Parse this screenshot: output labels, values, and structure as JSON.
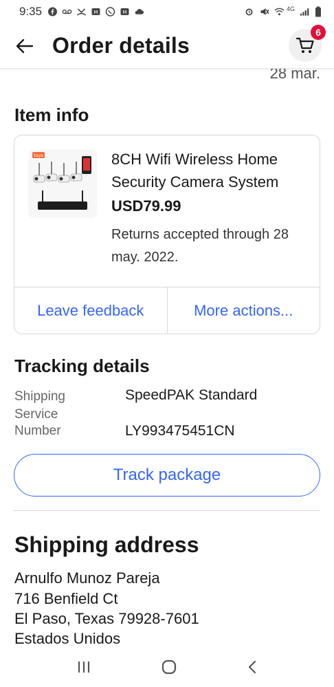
{
  "status_bar": {
    "time": "9:35",
    "network_label": "4G"
  },
  "header": {
    "title": "Order details",
    "cart_count": "6"
  },
  "date_stub": "28 mar.",
  "item_info": {
    "section_title": "Item info",
    "title": "8CH Wifi Wireless Home Security Camera System",
    "price": "USD79.99",
    "returns": "Returns accepted through 28 may. 2022.",
    "thumb_badge": "tuya",
    "actions": {
      "leave_feedback": "Leave feedback",
      "more_actions": "More actions..."
    }
  },
  "tracking": {
    "section_title": "Tracking details",
    "shipping_service_label": "Shipping Service",
    "shipping_service_value": "SpeedPAK Standard",
    "number_label": "Number",
    "number_value": "LY993475451CN",
    "track_button": "Track package"
  },
  "shipping_address": {
    "section_title": "Shipping address",
    "name": "Arnulfo Munoz Pareja",
    "street": "716 Benfield Ct",
    "city_state_zip": "El Paso, Texas 79928-7601",
    "country": "Estados Unidos"
  },
  "colors": {
    "accent": "#3665f3",
    "badge": "#e0103a",
    "text": "#191919",
    "muted": "#666666"
  },
  "icons": [
    "facebook-icon",
    "voicemail-icon",
    "missed-call-icon",
    "messenger-icon",
    "whatsapp-icon",
    "cloud-icon",
    "alarm-icon",
    "mute-icon",
    "wifi-icon",
    "signal-icon",
    "battery-icon",
    "back-arrow-icon",
    "cart-icon",
    "recent-apps-icon",
    "home-icon",
    "nav-back-icon"
  ]
}
